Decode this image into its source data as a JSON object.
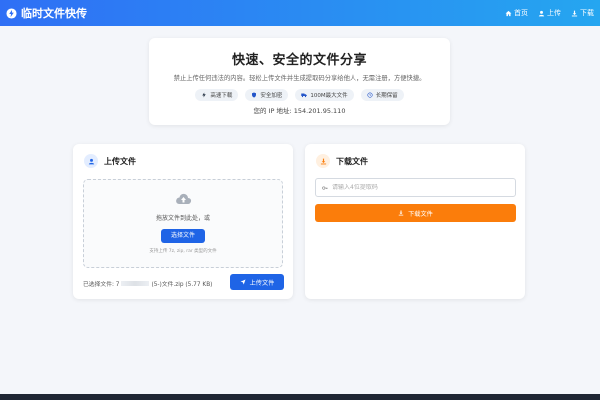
{
  "header": {
    "brand": "临时文件快传",
    "nav": [
      {
        "label": "首页",
        "icon": "home-icon"
      },
      {
        "label": "上传",
        "icon": "user-icon"
      },
      {
        "label": "下载",
        "icon": "download-icon"
      }
    ]
  },
  "hero": {
    "title": "快速、安全的文件分享",
    "subtitle": "禁止上传任何违法的内容。轻松上传文件并生成提取码分享给他人，无需注册，方便快捷。",
    "features": [
      {
        "label": "高速下载",
        "icon": "bolt-icon"
      },
      {
        "label": "安全加密",
        "icon": "shield-icon"
      },
      {
        "label": "100M最大文件",
        "icon": "truck-icon"
      },
      {
        "label": "长期保留",
        "icon": "clock-icon"
      }
    ],
    "ip_label": "您的 IP 地址:",
    "ip_value": "154.201.95.110"
  },
  "upload_card": {
    "title": "上传文件",
    "drop_text": "拖放文件到此处，或",
    "choose_label": "选择文件",
    "support_text": "支持上传 7z, zip, rar 类型的文件",
    "selected_prefix": "已选择文件: 7",
    "selected_suffix": "(5-)文件.zip (5.77 KB)",
    "upload_label": "上传文件"
  },
  "download_card": {
    "title": "下载文件",
    "code_placeholder": "请输入4位提取码",
    "download_label": "下载文件"
  },
  "colors": {
    "header_start": "#2f6ff5",
    "header_end": "#25a6f0",
    "primary": "#1f64e6",
    "accent_orange": "#fb7d0b"
  }
}
